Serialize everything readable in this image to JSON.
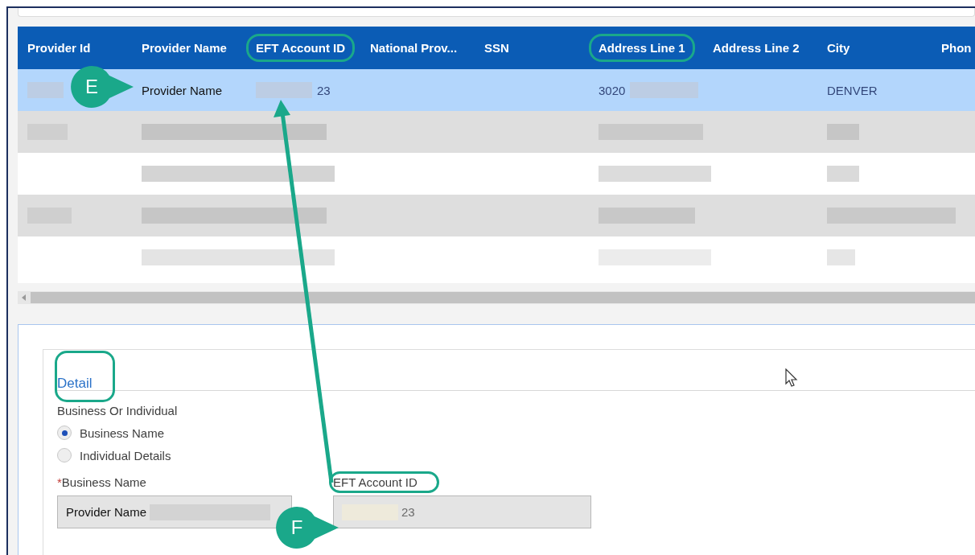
{
  "table": {
    "columns": [
      {
        "label": "Provider Id",
        "highlighted": false
      },
      {
        "label": "Provider Name",
        "highlighted": false
      },
      {
        "label": "EFT Account ID",
        "highlighted": true
      },
      {
        "label": "National Prov...",
        "highlighted": false
      },
      {
        "label": "SSN",
        "highlighted": false
      },
      {
        "label": "Address Line 1",
        "highlighted": true
      },
      {
        "label": "Address Line 2",
        "highlighted": false
      },
      {
        "label": "City",
        "highlighted": false
      },
      {
        "label": "Phon",
        "highlighted": false
      }
    ],
    "rows": [
      {
        "selected": true,
        "cells": [
          null,
          "Provider Name",
          "23",
          null,
          null,
          "3020",
          null,
          "DENVER",
          null
        ]
      },
      {
        "selected": false
      },
      {
        "selected": false
      },
      {
        "selected": false
      },
      {
        "selected": false
      }
    ]
  },
  "detail": {
    "tabs": [
      {
        "label": "Detail",
        "selected": true,
        "highlighted": true
      }
    ],
    "group_label": "Business Or Individual",
    "radios": [
      {
        "label": "Business Name",
        "selected": true
      },
      {
        "label": "Individual Details",
        "selected": false
      }
    ],
    "fields": [
      {
        "label": "Business Name",
        "required": true,
        "required_mark": "*",
        "value": "Provider Name",
        "highlighted": false
      },
      {
        "label": "EFT Account ID",
        "required": false,
        "value": "23",
        "highlighted": true
      }
    ]
  },
  "annotations": [
    {
      "letter": "E"
    },
    {
      "letter": "F"
    }
  ]
}
